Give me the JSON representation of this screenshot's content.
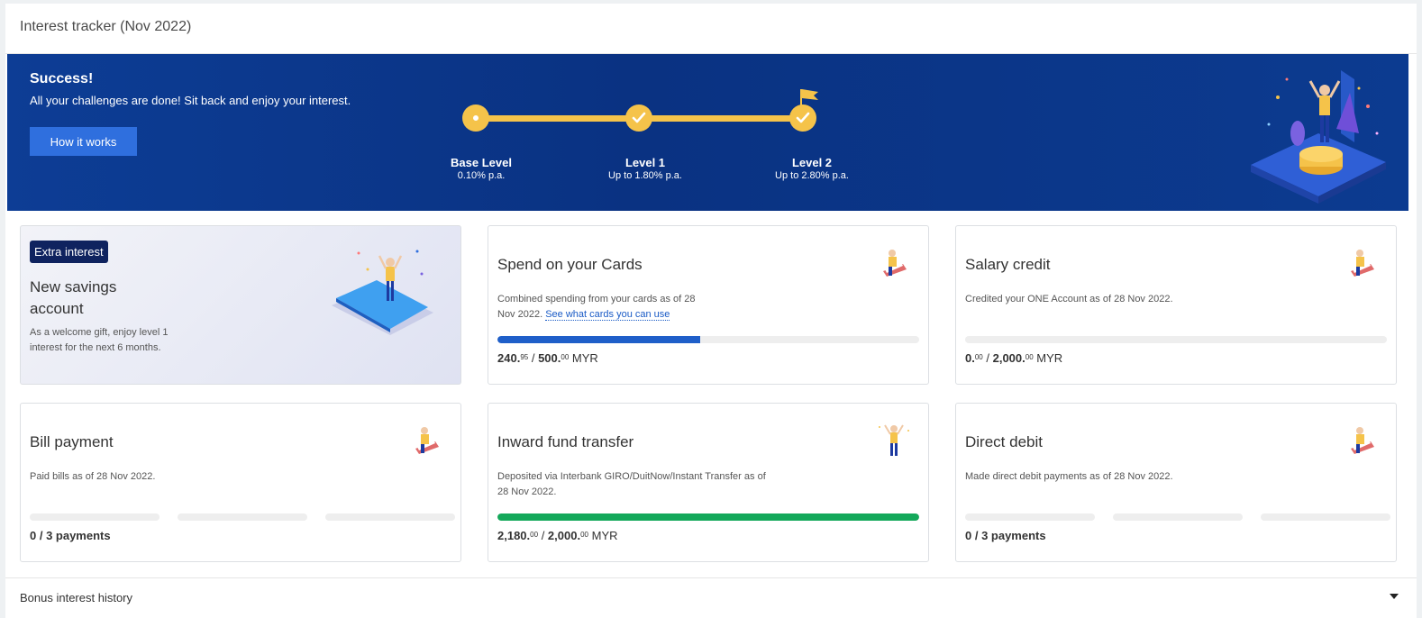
{
  "header": {
    "title": "Interest tracker (Nov 2022)"
  },
  "hero": {
    "title": "Success!",
    "subtitle": "All your challenges are done! Sit back and enjoy your interest.",
    "button_label": "How it works",
    "levels": [
      {
        "name": "Base Level",
        "rate": "0.10% p.a."
      },
      {
        "name": "Level 1",
        "rate": "Up to 1.80% p.a."
      },
      {
        "name": "Level 2",
        "rate": "Up to 2.80% p.a."
      }
    ],
    "track_color": "#f5c34a"
  },
  "promo": {
    "badge": "Extra interest",
    "title": "New savings account",
    "description": "As a welcome gift, enjoy level 1 interest for the next 6 months."
  },
  "cards": {
    "spend": {
      "title": "Spend on your Cards",
      "desc_pre": "Combined spending from your cards as of 28 Nov 2022.",
      "link": "See what cards you can use",
      "current_int": "240.",
      "current_dec": "95",
      "target_int": "500.",
      "target_dec": "00",
      "currency": "MYR",
      "progress": 0.48,
      "color": "#1f5fc9"
    },
    "salary": {
      "title": "Salary credit",
      "desc": "Credited your ONE Account as of 28 Nov 2022.",
      "current_int": "0.",
      "current_dec": "00",
      "target_int": "2,000.",
      "target_dec": "00",
      "currency": "MYR",
      "progress": 0
    },
    "bill": {
      "title": "Bill payment",
      "desc": "Paid bills as of 28 Nov 2022.",
      "count": "0 / 3 payments"
    },
    "inward": {
      "title": "Inward fund transfer",
      "desc": "Deposited via Interbank GIRO/DuitNow/Instant Transfer as of 28 Nov 2022.",
      "current_int": "2,180.",
      "current_dec": "00",
      "target_int": "2,000.",
      "target_dec": "00",
      "currency": "MYR",
      "progress": 1.0,
      "color": "#14a85a"
    },
    "direct": {
      "title": "Direct debit",
      "desc": "Made direct debit payments as of 28 Nov 2022.",
      "count": "0 / 3 payments"
    }
  },
  "history": {
    "label": "Bonus interest history"
  }
}
